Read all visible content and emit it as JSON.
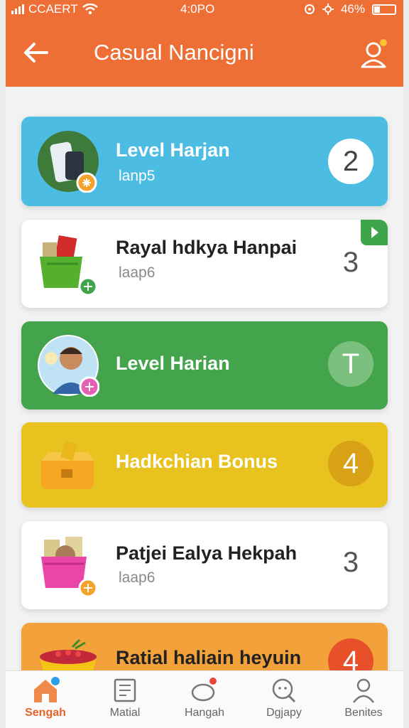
{
  "status": {
    "carrier": "CCAERT",
    "time": "4:0PO",
    "battery": "46%"
  },
  "header": {
    "title": "Casual Nancigni"
  },
  "items": [
    {
      "name": "Level Harjan",
      "sub": "lanp5",
      "count": "2"
    },
    {
      "name": "Rayal hdkya Hanpai",
      "sub": "laap6",
      "count": "3"
    },
    {
      "name": "Level Harian",
      "sub": "",
      "count": "T"
    },
    {
      "name": "Hadkchian Bonus",
      "sub": "",
      "count": "4"
    },
    {
      "name": "Patjei Ealya Hekpah",
      "sub": "laap6",
      "count": "3"
    },
    {
      "name": "Ratial haliain heyuin",
      "sub": "",
      "count": "4"
    }
  ],
  "tabs": [
    {
      "label": "Sengah"
    },
    {
      "label": "Matial"
    },
    {
      "label": "Hangah"
    },
    {
      "label": "Dgjapy"
    },
    {
      "label": "Benites"
    }
  ],
  "colors": {
    "header": "#ee6f35",
    "accent": "#e8632a"
  }
}
